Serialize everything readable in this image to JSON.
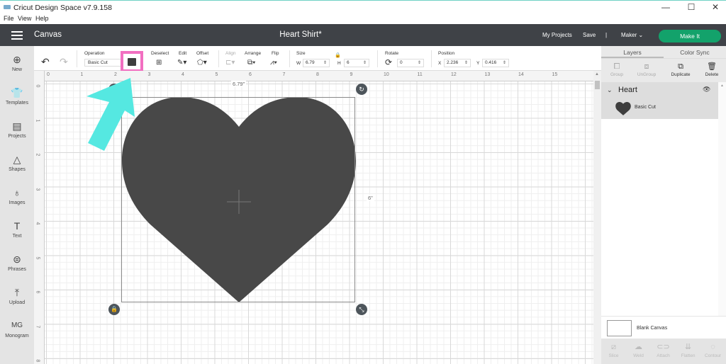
{
  "window": {
    "title": "Cricut Design Space  v7.9.158",
    "controls": {
      "minimize": "—",
      "maximize": "☐",
      "close": "✕"
    }
  },
  "menubar": {
    "items": [
      "File",
      "View",
      "Help"
    ]
  },
  "topbar": {
    "section": "Canvas",
    "document_title": "Heart Shirt*",
    "my_projects": "My Projects",
    "save": "Save",
    "separator": "|",
    "machine": "Maker",
    "make_it": "Make It",
    "accent_color": "#13a26b"
  },
  "leftbar": {
    "items": [
      {
        "label": "New",
        "icon": "plus-circle-icon",
        "glyph": "⊕"
      },
      {
        "label": "Templates",
        "icon": "tshirt-icon",
        "glyph": "👕"
      },
      {
        "label": "Projects",
        "icon": "projects-icon",
        "glyph": "▤"
      },
      {
        "label": "Shapes",
        "icon": "shapes-icon",
        "glyph": "△"
      },
      {
        "label": "Images",
        "icon": "lightbulb-icon",
        "glyph": "♁"
      },
      {
        "label": "Text",
        "icon": "text-icon",
        "glyph": "T"
      },
      {
        "label": "Phrases",
        "icon": "speech-bubble-icon",
        "glyph": "⊜"
      },
      {
        "label": "Upload",
        "icon": "upload-icon",
        "glyph": "⤒"
      },
      {
        "label": "Monogram",
        "icon": "monogram-icon",
        "glyph": "MG"
      }
    ]
  },
  "toolbar": {
    "undo": "↶",
    "redo": "↷",
    "operation": {
      "label": "Operation",
      "value": "Basic Cut"
    },
    "color_swatch": "#3e3e3e",
    "highlight_color": "#f26fc1",
    "deselect": {
      "label": "Deselect",
      "glyph": "⊞"
    },
    "edit": {
      "label": "Edit",
      "glyph": "✎▾"
    },
    "offset": {
      "label": "Offset",
      "glyph": "⬠▾"
    },
    "align": {
      "label": "Align",
      "glyph": "⊏▾"
    },
    "arrange": {
      "label": "Arrange",
      "glyph": "⧉▾"
    },
    "flip": {
      "label": "Flip",
      "glyph": "⩘▾"
    },
    "size": {
      "label": "Size",
      "w_label": "W",
      "w_value": "6.79",
      "h_label": "H",
      "h_value": "6",
      "lock_glyph": "🔒"
    },
    "rotate": {
      "label": "Rotate",
      "value": "0",
      "glyph": "⟳"
    },
    "position": {
      "label": "Position",
      "x_label": "X",
      "x_value": "2.236",
      "y_label": "Y",
      "y_value": "0.416"
    },
    "spin_glyph": "⇕"
  },
  "canvas": {
    "ruler_h": [
      "0",
      "1",
      "2",
      "3",
      "4",
      "5",
      "6",
      "7",
      "8",
      "9",
      "10",
      "11",
      "12",
      "13",
      "14",
      "15"
    ],
    "ruler_v": [
      "0",
      "1",
      "2",
      "3",
      "4",
      "5",
      "6",
      "7",
      "8"
    ],
    "width_label": "6.79\"",
    "height_label": "6\"",
    "shape_color": "#484848",
    "annotation_arrow_color": "#55e8e1",
    "handles": {
      "delete": "✕",
      "rotate": "↻",
      "lock": "🔒",
      "resize": "⤡"
    }
  },
  "right_panel": {
    "tabs": [
      "Layers",
      "Color Sync"
    ],
    "actions": [
      {
        "label": "Group",
        "glyph": "⧠",
        "enabled": false
      },
      {
        "label": "UnGroup",
        "glyph": "⧈",
        "enabled": false
      },
      {
        "label": "Duplicate",
        "glyph": "⧉",
        "enabled": true
      },
      {
        "label": "Delete",
        "glyph": "🗑",
        "enabled": true
      }
    ],
    "group": {
      "name": "Heart",
      "chevron": "⌄",
      "eye": "👁"
    },
    "layer": {
      "name": "Basic Cut"
    },
    "blank_canvas": "Blank Canvas",
    "bottom_actions": [
      {
        "label": "Slice",
        "glyph": "⧄"
      },
      {
        "label": "Weld",
        "glyph": "☁"
      },
      {
        "label": "Attach",
        "glyph": "⊂⊃"
      },
      {
        "label": "Flatten",
        "glyph": "⇊"
      },
      {
        "label": "Contour",
        "glyph": "◌"
      }
    ]
  }
}
